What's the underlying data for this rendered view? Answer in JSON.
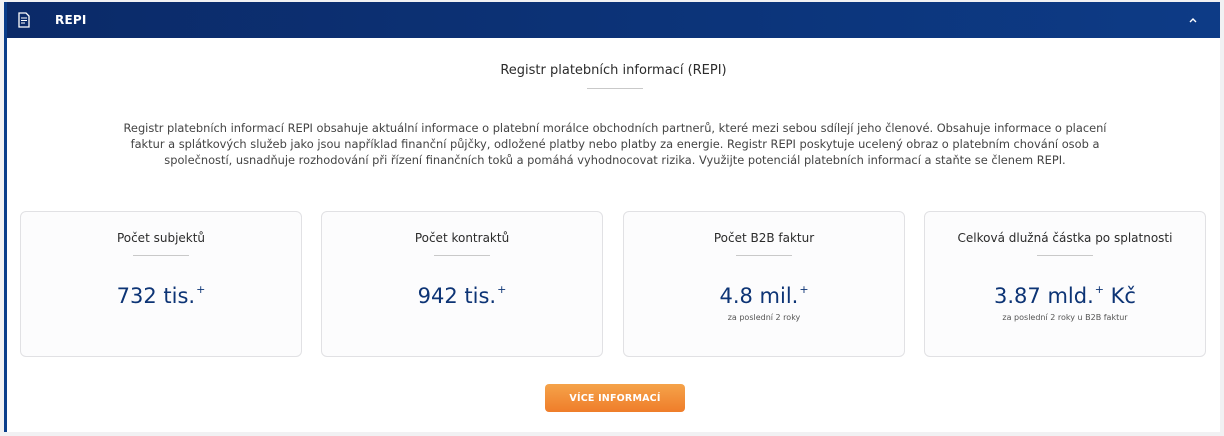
{
  "header": {
    "title": "REPI",
    "icon": "document-icon",
    "toggle_icon": "chevron-up-icon"
  },
  "main": {
    "title": "Registr platebních informací (REPI)",
    "description": "Registr platebních informací REPI obsahuje aktuální informace o platební morálce obchodních partnerů, které mezi sebou sdílejí jeho členové. Obsahuje informace o placení faktur a splátkových služeb jako jsou například finanční půjčky, odložené platby nebo platby za energie. Registr REPI poskytuje ucelený obraz o platebním chování osob a společností, usnadňuje rozhodování při řízení finančních toků a pomáhá vyhodnocovat rizika. Využijte potenciál platebních informací a staňte se členem REPI."
  },
  "stats": [
    {
      "label": "Počet subjektů",
      "value": "732 tis.",
      "suffix": "+",
      "unit": "",
      "note": ""
    },
    {
      "label": "Počet kontraktů",
      "value": "942 tis.",
      "suffix": "+",
      "unit": "",
      "note": ""
    },
    {
      "label": "Počet B2B faktur",
      "value": "4.8 mil.",
      "suffix": "+",
      "unit": "",
      "note": "za poslední 2 roky"
    },
    {
      "label": "Celková dlužná částka po splatnosti",
      "value": "3.87 mld.",
      "suffix": "+",
      "unit": " Kč",
      "note": "za poslední 2 roky u B2B faktur"
    }
  ],
  "cta": {
    "label": "VÍCE INFORMACÍ"
  },
  "colors": {
    "header_bg": "#0b2a68",
    "accent": "#0d3475",
    "cta": "#ef7d2a"
  }
}
